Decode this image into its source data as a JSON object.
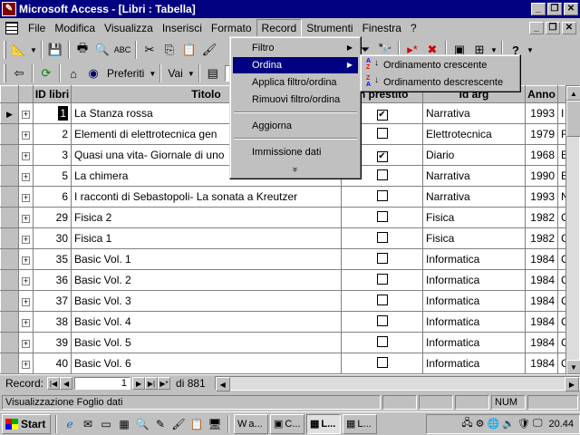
{
  "window": {
    "title": "Microsoft Access - [Libri : Tabella]",
    "app_icon": "access-key-icon"
  },
  "menu": {
    "items": [
      "File",
      "Modifica",
      "Visualizza",
      "Inserisci",
      "Formato",
      "Record",
      "Strumenti",
      "Finestra",
      "?"
    ],
    "active": "Record"
  },
  "toolbar2": {
    "favorites_label": "Preferiti",
    "goto_label": "Vai"
  },
  "record_menu": {
    "items": [
      {
        "label": "Filtro",
        "submenu": true
      },
      {
        "label": "Ordina",
        "submenu": true,
        "highlighted": true
      },
      {
        "label": "Applica filtro/ordina"
      },
      {
        "label": "Rimuovi filtro/ordina"
      },
      {
        "label": "Aggiorna"
      },
      {
        "label": "Immissione dati"
      }
    ],
    "more": "»"
  },
  "sort_submenu": {
    "items": [
      {
        "label": "Ordinamento crescente",
        "icon": "sort-ascending-icon"
      },
      {
        "label": "Ordinamento descrescente",
        "icon": "sort-descending-icon"
      }
    ]
  },
  "grid": {
    "columns": [
      "ID libri",
      "Titolo",
      "In prestito",
      "Id arg",
      "Anno"
    ],
    "rows": [
      {
        "id": "1",
        "title": "La Stanza rossa",
        "loan": true,
        "arg": "Narrativa",
        "year": "1993",
        "extra": "I"
      },
      {
        "id": "2",
        "title": "Elementi di elettrotecnica gen",
        "loan": false,
        "arg": "Elettrotecnica",
        "year": "1979",
        "extra": "F"
      },
      {
        "id": "3",
        "title": "Quasi una vita- Giornale di uno",
        "loan": true,
        "arg": "Diario",
        "year": "1968",
        "extra": "E"
      },
      {
        "id": "5",
        "title": "La chimera",
        "loan": false,
        "arg": "Narrativa",
        "year": "1990",
        "extra": "E"
      },
      {
        "id": "6",
        "title": "I racconti di Sebastopoli- La sonata a Kreutzer",
        "loan": false,
        "arg": "Narrativa",
        "year": "1993",
        "extra": "N"
      },
      {
        "id": "29",
        "title": "Fisica 2",
        "loan": false,
        "arg": "Fisica",
        "year": "1982",
        "extra": "C"
      },
      {
        "id": "30",
        "title": "Fisica 1",
        "loan": false,
        "arg": "Fisica",
        "year": "1982",
        "extra": "C"
      },
      {
        "id": "35",
        "title": "Basic Vol. 1",
        "loan": false,
        "arg": "Informatica",
        "year": "1984",
        "extra": "C"
      },
      {
        "id": "36",
        "title": "Basic Vol. 2",
        "loan": false,
        "arg": "Informatica",
        "year": "1984",
        "extra": "C"
      },
      {
        "id": "37",
        "title": "Basic Vol. 3",
        "loan": false,
        "arg": "Informatica",
        "year": "1984",
        "extra": "C"
      },
      {
        "id": "38",
        "title": "Basic Vol. 4",
        "loan": false,
        "arg": "Informatica",
        "year": "1984",
        "extra": "C"
      },
      {
        "id": "39",
        "title": "Basic Vol. 5",
        "loan": false,
        "arg": "Informatica",
        "year": "1984",
        "extra": "C"
      },
      {
        "id": "40",
        "title": "Basic Vol. 6",
        "loan": false,
        "arg": "Informatica",
        "year": "1984",
        "extra": "C"
      }
    ]
  },
  "record_nav": {
    "label": "Record:",
    "current": "1",
    "total": "di 881"
  },
  "status": {
    "text": "Visualizzazione Foglio dati",
    "num": "NUM"
  },
  "taskbar": {
    "start": "Start",
    "tasks": [
      "a...",
      "C...",
      "L...",
      "L..."
    ],
    "active_task": 2,
    "clock": "20.44"
  },
  "colors": {
    "titlebar": "#000080",
    "highlight": "#000080",
    "face": "#c0c0c0"
  }
}
